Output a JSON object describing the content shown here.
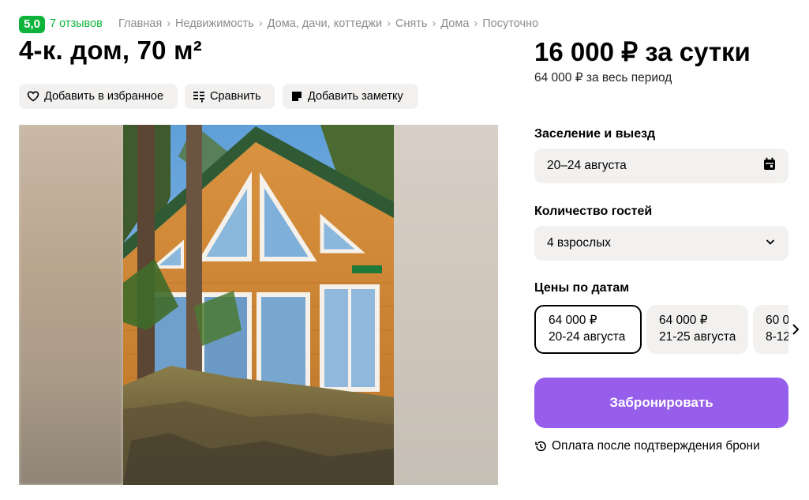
{
  "rating": {
    "score": "5,0",
    "reviews": "7 отзывов"
  },
  "breadcrumbs": [
    "Главная",
    "Недвижимость",
    "Дома, дачи, коттеджи",
    "Снять",
    "Дома",
    "Посуточно"
  ],
  "title": "4-к. дом, 70 м²",
  "actions": {
    "favorite": "Добавить в избранное",
    "compare": "Сравнить",
    "note": "Добавить заметку"
  },
  "price": {
    "main": "16 000 ₽ за сутки",
    "period": "64 000 ₽ за весь период"
  },
  "booking": {
    "dates_label": "Заселение и выезд",
    "dates_value": "20–24 августа",
    "guests_label": "Количество гостей",
    "guests_value": "4 взрослых",
    "prices_label": "Цены по датам",
    "price_options": [
      {
        "price": "64 000 ₽",
        "dates": "20-24 августа",
        "selected": true
      },
      {
        "price": "64 000 ₽",
        "dates": "21-25 августа",
        "selected": false
      },
      {
        "price": "60 0",
        "dates": "8-12",
        "selected": false
      }
    ],
    "book_label": "Забронировать",
    "payment_note": "Оплата после подтверждения брони"
  },
  "colors": {
    "accent_green": "#0db33b",
    "book_purple": "#965eeb",
    "field_bg": "#f2f1f0"
  }
}
